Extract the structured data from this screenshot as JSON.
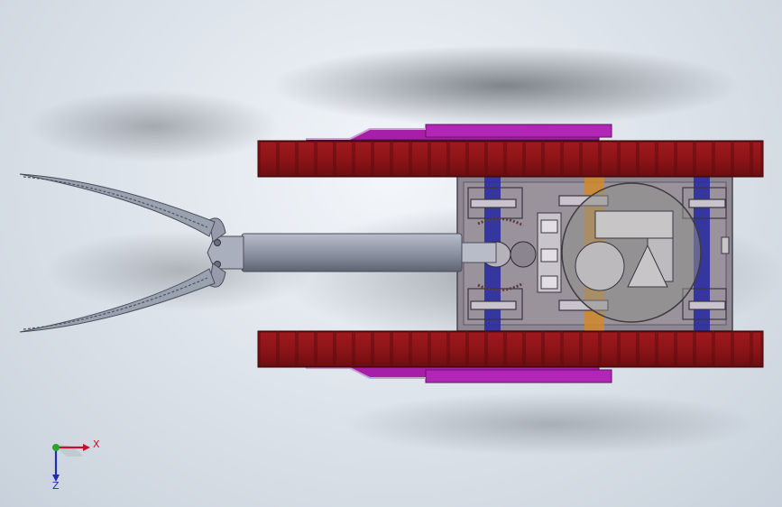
{
  "triad": {
    "x_label": "X",
    "z_label": "Z",
    "colors": {
      "x": "#c8102e",
      "y": "#2aa52a",
      "z": "#1f2fa8"
    }
  },
  "model": {
    "colors": {
      "track": "#8e1418",
      "track_dark": "#5c0b0e",
      "rail": "#a51fa8",
      "hull": "#8f8a90",
      "arm": "#7f8596",
      "blade": "#9098a6",
      "axle": "#2a2d9c",
      "orange_shaft": "#d08a2a"
    }
  }
}
